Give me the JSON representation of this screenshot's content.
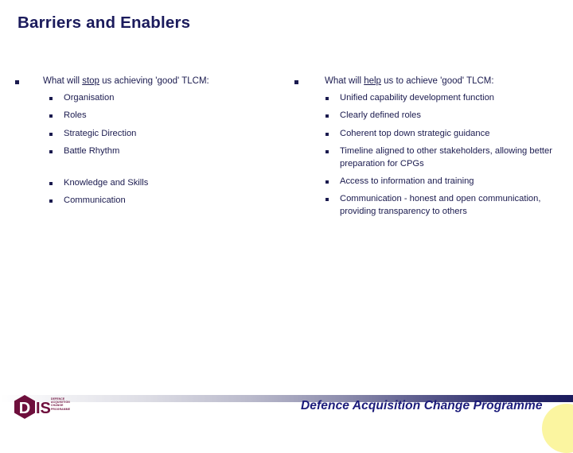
{
  "slide": {
    "title": "Barriers and Enablers",
    "title_color": "#1b1b5c",
    "background_color": "#ffffff"
  },
  "left_column": {
    "heading_prefix": "What will ",
    "heading_emphasis": "stop",
    "heading_suffix": " us achieving 'good' TLCM:",
    "items": [
      "Organisation",
      "Roles",
      "Strategic Direction",
      "Battle Rhythm"
    ],
    "items_after_gap": [
      "Knowledge and Skills",
      "Communication"
    ]
  },
  "right_column": {
    "heading_prefix": "What will ",
    "heading_emphasis": "help",
    "heading_suffix": " us to achieve 'good' TLCM:",
    "items": [
      "Unified capability development function",
      "Clearly defined roles",
      "Coherent top down strategic guidance",
      "Timeline aligned to other stakeholders, allowing better preparation for CPGs",
      "Access to information and training",
      "Communication - honest and open communication, providing transparency to others"
    ]
  },
  "footer": {
    "text": "Defence Acquisition Change Programme",
    "text_color": "#1b1b7a",
    "bar_gradient_from": "#ffffff",
    "bar_gradient_to": "#1b1b5c",
    "accent_blob_color": "#fbf5a0"
  },
  "logo": {
    "letters": "DIS",
    "letter_d": "D",
    "letters_is": "IS",
    "color": "#6e0f3c",
    "wordmark_lines": [
      "Defence",
      "Acquisition",
      "Change",
      "Programme"
    ]
  }
}
